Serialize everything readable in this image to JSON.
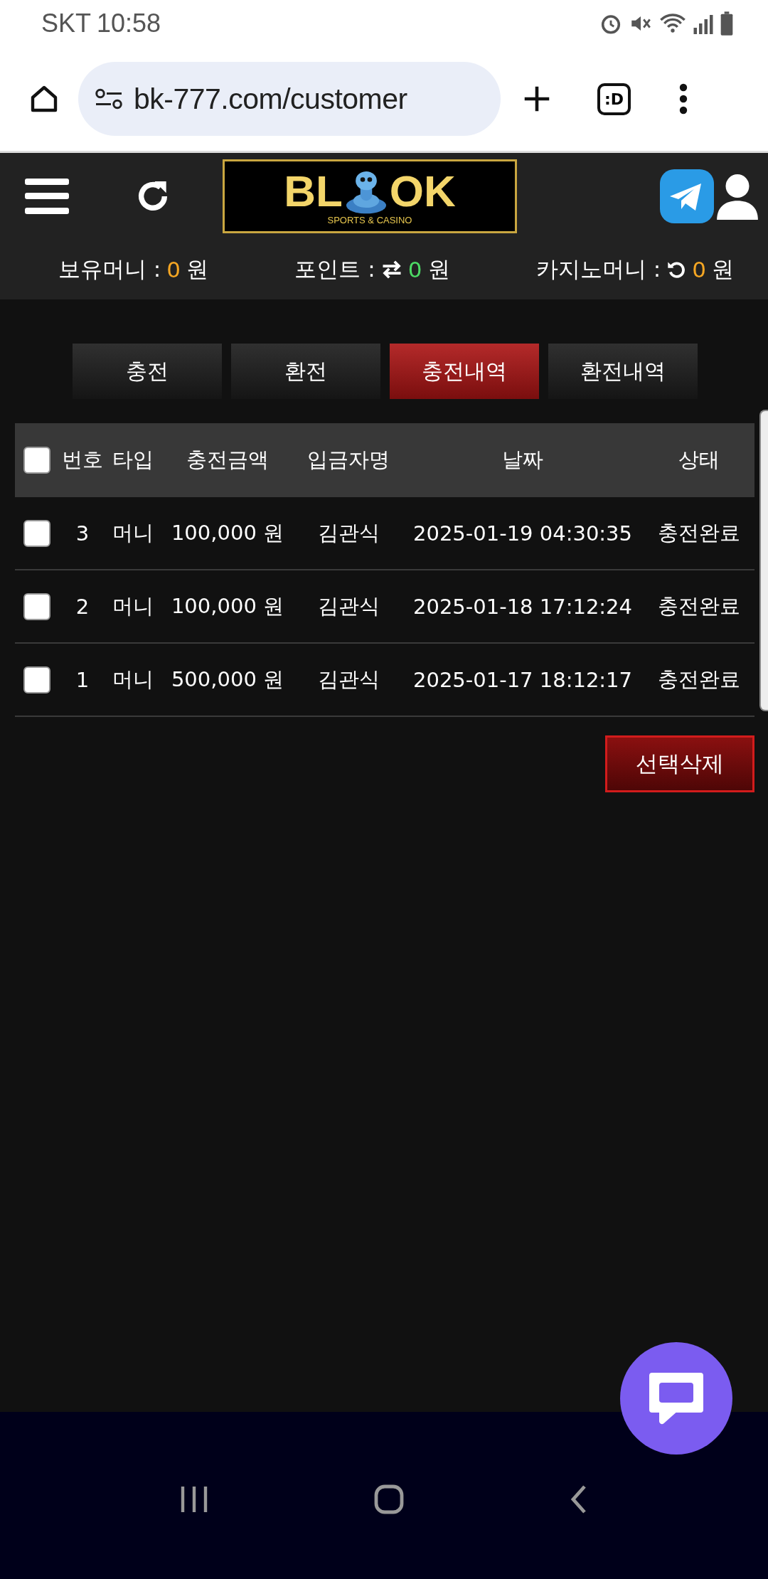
{
  "status_bar": {
    "carrier": "SKT",
    "time": "10:58"
  },
  "browser": {
    "url": "bk-777.com/customer",
    "tab_label": ":D"
  },
  "header": {
    "logo": {
      "left": "BL",
      "right": "OK",
      "tagline": "SPORTS & CASINO"
    }
  },
  "balances": [
    {
      "label": "보유머니 :",
      "kind": "plain",
      "value": "0",
      "unit": "원",
      "color": "#f5a623"
    },
    {
      "label": "포인트 :",
      "kind": "exchange",
      "value": "0",
      "unit": "원",
      "color": "#4cd964"
    },
    {
      "label": "카지노머니 :",
      "kind": "refresh",
      "value": "0",
      "unit": "원",
      "color": "#f5a623"
    }
  ],
  "tabs": [
    {
      "label": "충전",
      "selected": false
    },
    {
      "label": "환전",
      "selected": false
    },
    {
      "label": "충전내역",
      "selected": true
    },
    {
      "label": "환전내역",
      "selected": false
    }
  ],
  "table": {
    "select_all": {
      "checked": false
    },
    "columns": [
      "번호",
      "타입",
      "충전금액",
      "입금자명",
      "날짜",
      "상태"
    ],
    "rows": [
      {
        "checked": false,
        "cells": [
          "3",
          "머니",
          "100,000 원",
          "김관식",
          "2025-01-19 04:30:35",
          "충전완료"
        ]
      },
      {
        "checked": false,
        "cells": [
          "2",
          "머니",
          "100,000 원",
          "김관식",
          "2025-01-18 17:12:24",
          "충전완료"
        ]
      },
      {
        "checked": false,
        "cells": [
          "1",
          "머니",
          "500,000 원",
          "김관식",
          "2025-01-17 18:12:17",
          "충전완료"
        ]
      }
    ]
  },
  "delete_button": "선택삭제"
}
